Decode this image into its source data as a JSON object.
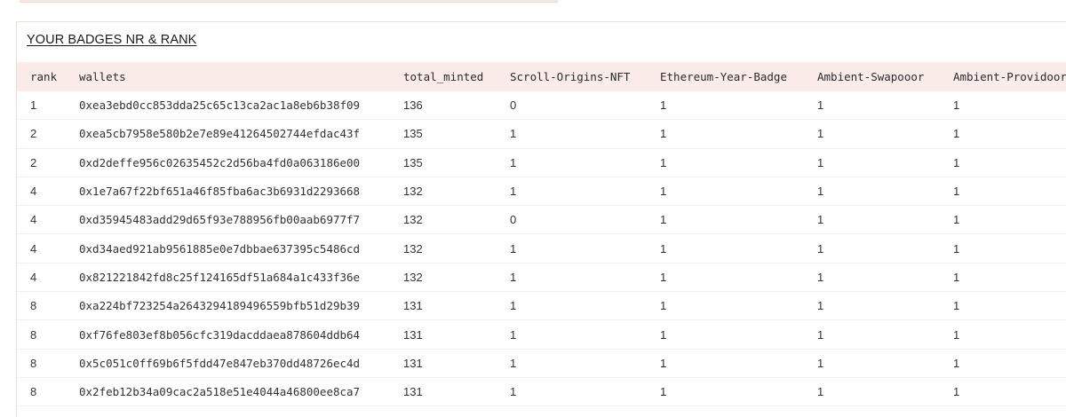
{
  "panel": {
    "title": "YOUR BADGES NR & RANK"
  },
  "table": {
    "columns": [
      "rank",
      "wallets",
      "total_minted",
      "Scroll-Origins-NFT",
      "Ethereum-Year-Badge",
      "Ambient-Swapooor",
      "Ambient-Providoor"
    ],
    "rows": [
      {
        "rank": "1",
        "wallet": "0xea3ebd0cc853dda25c65c13ca2ac1a8eb6b38f09",
        "total_minted": "136",
        "scroll_origins_nft": "0",
        "ethereum_year_badge": "1",
        "ambient_swapooor": "1",
        "ambient_providoor": "1"
      },
      {
        "rank": "2",
        "wallet": "0xea5cb7958e580b2e7e89e41264502744efdac43f",
        "total_minted": "135",
        "scroll_origins_nft": "1",
        "ethereum_year_badge": "1",
        "ambient_swapooor": "1",
        "ambient_providoor": "1"
      },
      {
        "rank": "2",
        "wallet": "0xd2deffe956c02635452c2d56ba4fd0a063186e00",
        "total_minted": "135",
        "scroll_origins_nft": "1",
        "ethereum_year_badge": "1",
        "ambient_swapooor": "1",
        "ambient_providoor": "1"
      },
      {
        "rank": "4",
        "wallet": "0x1e7a67f22bf651a46f85fba6ac3b6931d2293668",
        "total_minted": "132",
        "scroll_origins_nft": "1",
        "ethereum_year_badge": "1",
        "ambient_swapooor": "1",
        "ambient_providoor": "1"
      },
      {
        "rank": "4",
        "wallet": "0xd35945483add29d65f93e788956fb00aab6977f7",
        "total_minted": "132",
        "scroll_origins_nft": "0",
        "ethereum_year_badge": "1",
        "ambient_swapooor": "1",
        "ambient_providoor": "1"
      },
      {
        "rank": "4",
        "wallet": "0xd34aed921ab9561885e0e7dbbae637395c5486cd",
        "total_minted": "132",
        "scroll_origins_nft": "1",
        "ethereum_year_badge": "1",
        "ambient_swapooor": "1",
        "ambient_providoor": "1"
      },
      {
        "rank": "4",
        "wallet": "0x821221842fd8c25f124165df51a684a1c433f36e",
        "total_minted": "132",
        "scroll_origins_nft": "1",
        "ethereum_year_badge": "1",
        "ambient_swapooor": "1",
        "ambient_providoor": "1"
      },
      {
        "rank": "8",
        "wallet": "0xa224bf723254a2643294189496559bfb51d29b39",
        "total_minted": "131",
        "scroll_origins_nft": "1",
        "ethereum_year_badge": "1",
        "ambient_swapooor": "1",
        "ambient_providoor": "1"
      },
      {
        "rank": "8",
        "wallet": "0xf76fe803ef8b056cfc319dacddaea878604ddb64",
        "total_minted": "131",
        "scroll_origins_nft": "1",
        "ethereum_year_badge": "1",
        "ambient_swapooor": "1",
        "ambient_providoor": "1"
      },
      {
        "rank": "8",
        "wallet": "0x5c051c0ff69b6f5fdd47e847eb370dd48726ec4d",
        "total_minted": "131",
        "scroll_origins_nft": "1",
        "ethereum_year_badge": "1",
        "ambient_swapooor": "1",
        "ambient_providoor": "1"
      },
      {
        "rank": "8",
        "wallet": "0x2feb12b34a09cac2a518e51e4044a46800ee8ca7",
        "total_minted": "131",
        "scroll_origins_nft": "1",
        "ethereum_year_badge": "1",
        "ambient_swapooor": "1",
        "ambient_providoor": "1"
      }
    ]
  },
  "colors": {
    "header_bg": "#fbecea",
    "panel_border": "#efdcd6",
    "text": "#333333"
  }
}
